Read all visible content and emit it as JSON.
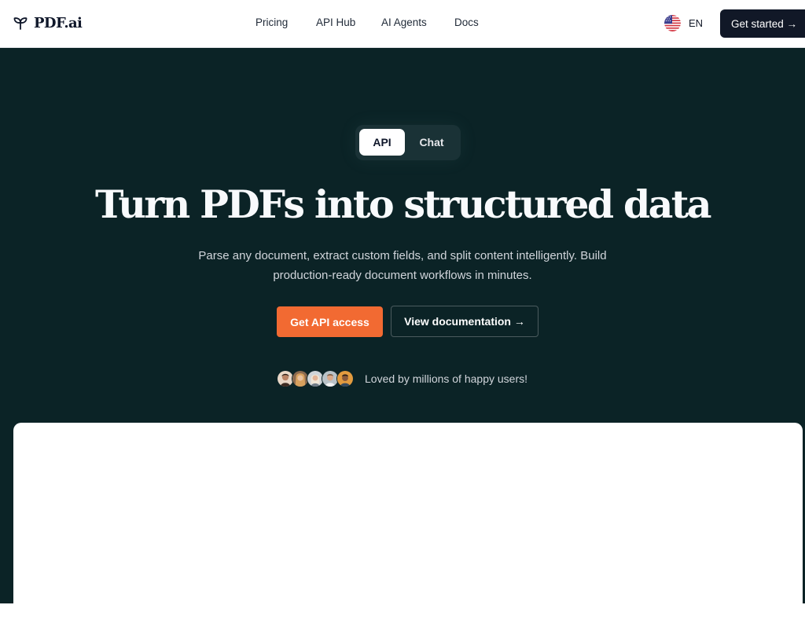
{
  "header": {
    "logo_text": "PDF.ai",
    "nav": [
      {
        "label": "Pricing"
      },
      {
        "label": "API Hub"
      },
      {
        "label": "AI Agents"
      },
      {
        "label": "Docs"
      }
    ],
    "language_code": "EN",
    "get_started_label": "Get started →"
  },
  "hero": {
    "toggle": {
      "api_label": "API",
      "chat_label": "Chat",
      "selected": "API"
    },
    "title": "Turn PDFs into structured data",
    "subtitle": "Parse any document, extract custom fields, and split content intelligently. Build production-ready document workflows in minutes.",
    "primary_cta": "Get API access",
    "secondary_cta": "View documentation →",
    "social_proof": "Loved by millions of happy users!"
  },
  "icons": {
    "logo": "sprout-icon",
    "language_flag": "us-flag-icon",
    "avatars": [
      "user-avatar-1",
      "user-avatar-2",
      "user-avatar-3",
      "user-avatar-4",
      "user-avatar-5"
    ]
  },
  "colors": {
    "hero_background": "#0b2326",
    "primary_cta": "#f26a32",
    "header_button": "#111827",
    "toggle_background": "#1a3236"
  }
}
